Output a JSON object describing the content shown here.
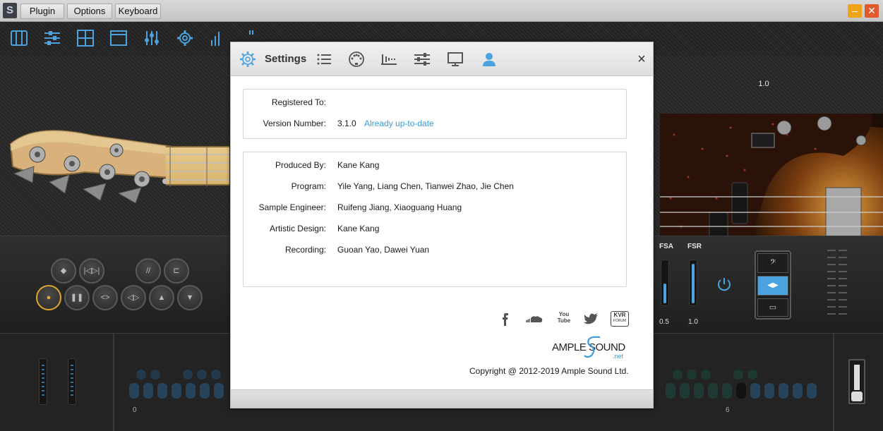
{
  "menubar": {
    "logo": "S",
    "menus": [
      {
        "label": "Plugin"
      },
      {
        "label": "Options"
      },
      {
        "label": "Keyboard"
      }
    ],
    "minimize_glyph": "–",
    "close_glyph": "✕",
    "minimize_color": "#f0a31a",
    "close_color": "#e05a2b"
  },
  "toolbar": {
    "icons": [
      "piano-keys-icon",
      "mixer-sliders-icon",
      "grid-panel-icon",
      "window-panel-icon",
      "equalizer-icon",
      "gear-icon",
      "bar-chart-icon",
      "partial-icon"
    ],
    "accent": "#4aa3df"
  },
  "instrument": {
    "neck_marker": "1.0",
    "brand": "AMPLE SOUND"
  },
  "controls": {
    "fsa_label": "FSA",
    "fsr_label": "FSR",
    "fsa_value": "0.5",
    "fsr_value": "1.0",
    "buttons_row1": [
      "◆",
      "|◁▷|",
      "//",
      "⊏"
    ],
    "buttons_row2": [
      "●",
      "❚❚",
      "<>",
      "◁▷",
      "▲",
      "▼"
    ],
    "right_buttons": [
      "guitar-icon",
      "arrows-icon",
      "pattern-icon"
    ]
  },
  "bottom": {
    "left_marker": "0",
    "right_marker": "6"
  },
  "settings": {
    "title": "Settings",
    "close_glyph": "×",
    "tab_icons": [
      "gear-icon",
      "list-icon",
      "midi-icon",
      "waveform-icon",
      "sliders-icon",
      "monitor-icon",
      "user-icon"
    ],
    "registration": {
      "registered_label": "Registered To:",
      "registered_value": "",
      "version_label": "Version Number:",
      "version_value": "3.1.0",
      "update_link": "Already up-to-date"
    },
    "credits": [
      {
        "label": "Produced By:",
        "value": "Kane Kang"
      },
      {
        "label": "Program:",
        "value": "Yile Yang, Liang Chen, Tianwei Zhao, Jie Chen"
      },
      {
        "label": "Sample Engineer:",
        "value": "Ruifeng Jiang, Xiaoguang Huang"
      },
      {
        "label": "Artistic Design:",
        "value": "Kane Kang"
      },
      {
        "label": "Recording:",
        "value": "Guoan Yao, Dawei Yuan"
      }
    ],
    "social_icons": [
      "facebook-icon",
      "soundcloud-icon",
      "youtube-icon",
      "twitter-icon",
      "kvr-forum-icon"
    ],
    "youtube_text": "You Tube",
    "kvr_text": "KVR",
    "kvr_sub": "FORUM",
    "logo_text_ample": "AMPLE",
    "logo_text_sound": "SOUND",
    "logo_text_net": ".net",
    "copyright": "Copyright @ 2012-2019 Ample Sound Ltd.",
    "link_color": "#3a9ad9"
  }
}
